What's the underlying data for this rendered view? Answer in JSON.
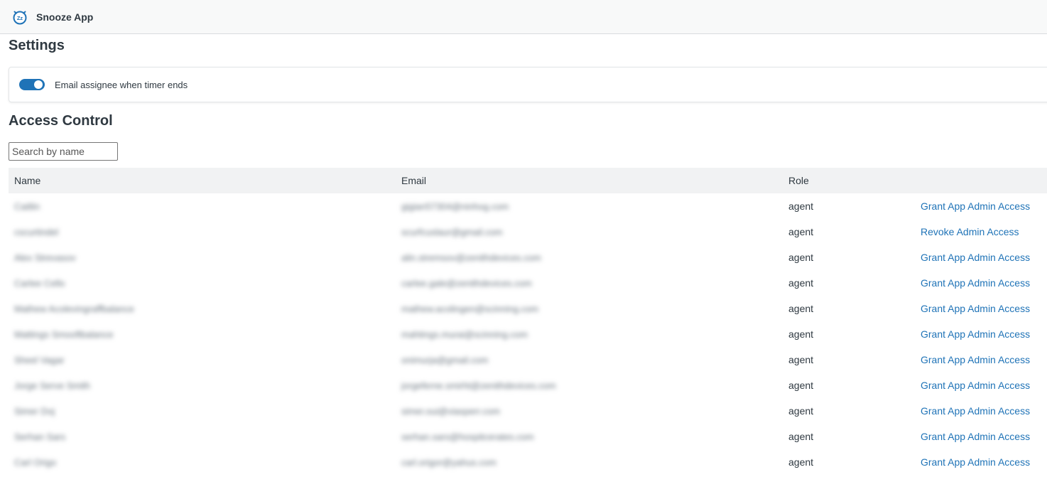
{
  "header": {
    "app_title": "Snooze App",
    "logo_icon": "snooze-clock-icon",
    "logo_text": "Zz"
  },
  "settings": {
    "title": "Settings",
    "email_toggle": {
      "label": "Email assignee when timer ends",
      "enabled": true
    }
  },
  "access_control": {
    "title": "Access Control",
    "search_placeholder": "Search by name",
    "columns": {
      "name": "Name",
      "email": "Email",
      "role": "Role"
    },
    "rows": [
      {
        "name": "Caitlin",
        "email": "gigian57304@ninhog.com",
        "role": "agent",
        "action": "Grant App Admin Access"
      },
      {
        "name": "cscurtindel",
        "email": "scurfcuslaur@gmail.com",
        "role": "agent",
        "action": "Revoke Admin Access"
      },
      {
        "name": "Alex Strevasov",
        "email": "alin.stremsov@zenithdevices.com",
        "role": "agent",
        "action": "Grant App Admin Access"
      },
      {
        "name": "Carlee Cello",
        "email": "carlee.gale@zenithdevices.com",
        "role": "agent",
        "action": "Grant App Admin Access"
      },
      {
        "name": "Mathew Acolevingraffbalance",
        "email": "mathew.acolingen@scinning.com",
        "role": "agent",
        "action": "Grant App Admin Access"
      },
      {
        "name": "Mattings Smooftbalance",
        "email": "mahtings.murai@scinning.com",
        "role": "agent",
        "action": "Grant App Admin Access"
      },
      {
        "name": "Sheel Vagar",
        "email": "onimurja@gmail.com",
        "role": "agent",
        "action": "Grant App Admin Access"
      },
      {
        "name": "Jorge Serve Smith",
        "email": "jorgeferne.smirht@zenithdevices.com",
        "role": "agent",
        "action": "Grant App Admin Access"
      },
      {
        "name": "Simer Doj",
        "email": "simer.oui@viasperr.com",
        "role": "agent",
        "action": "Grant App Admin Access"
      },
      {
        "name": "Serhan Sars",
        "email": "serhan.sars@hospitcerates.com",
        "role": "agent",
        "action": "Grant App Admin Access"
      },
      {
        "name": "Carl Origo",
        "email": "carl.origor@yahus.com",
        "role": "agent",
        "action": "Grant App Admin Access"
      }
    ]
  }
}
